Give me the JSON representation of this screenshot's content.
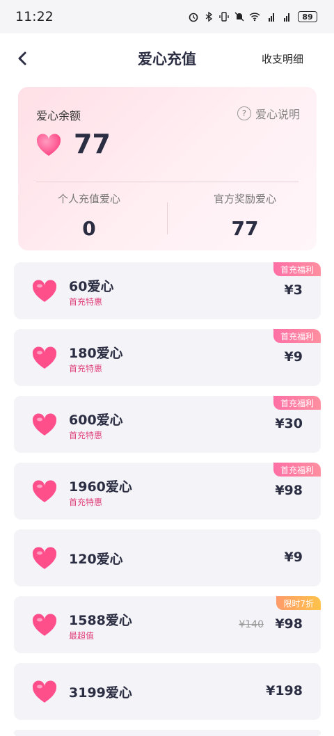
{
  "status": {
    "time": "11:22",
    "battery": "89"
  },
  "nav": {
    "title": "爱心充值",
    "right_label": "收支明细"
  },
  "balance": {
    "label": "爱心余额",
    "help": "爱心说明",
    "value": "77",
    "personal_label": "个人充值爱心",
    "personal_value": "0",
    "official_label": "官方奖励爱心",
    "official_value": "77"
  },
  "packages": [
    {
      "name": "60爱心",
      "sub": "首充特惠",
      "price": "¥3",
      "badge": "首充福利",
      "badge_color": "#ff7aa3"
    },
    {
      "name": "180爱心",
      "sub": "首充特惠",
      "price": "¥9",
      "badge": "首充福利",
      "badge_color": "#ff7aa3"
    },
    {
      "name": "600爱心",
      "sub": "首充特惠",
      "price": "¥30",
      "badge": "首充福利",
      "badge_color": "#ff7aa3"
    },
    {
      "name": "1960爱心",
      "sub": "首充特惠",
      "price": "¥98",
      "badge": "首充福利",
      "badge_color": "#ff7aa3"
    },
    {
      "name": "120爱心",
      "price": "¥9"
    },
    {
      "name": "1588爱心",
      "sub": "最超值",
      "price": "¥98",
      "old_price": "¥140",
      "badge": "限时7折",
      "badge_color": "#ffa85a"
    },
    {
      "name": "3199爱心",
      "price": "¥198"
    }
  ],
  "colors": {
    "accent": "#e0407a",
    "heart": "#ff4f8b",
    "text": "#2b2d42"
  }
}
